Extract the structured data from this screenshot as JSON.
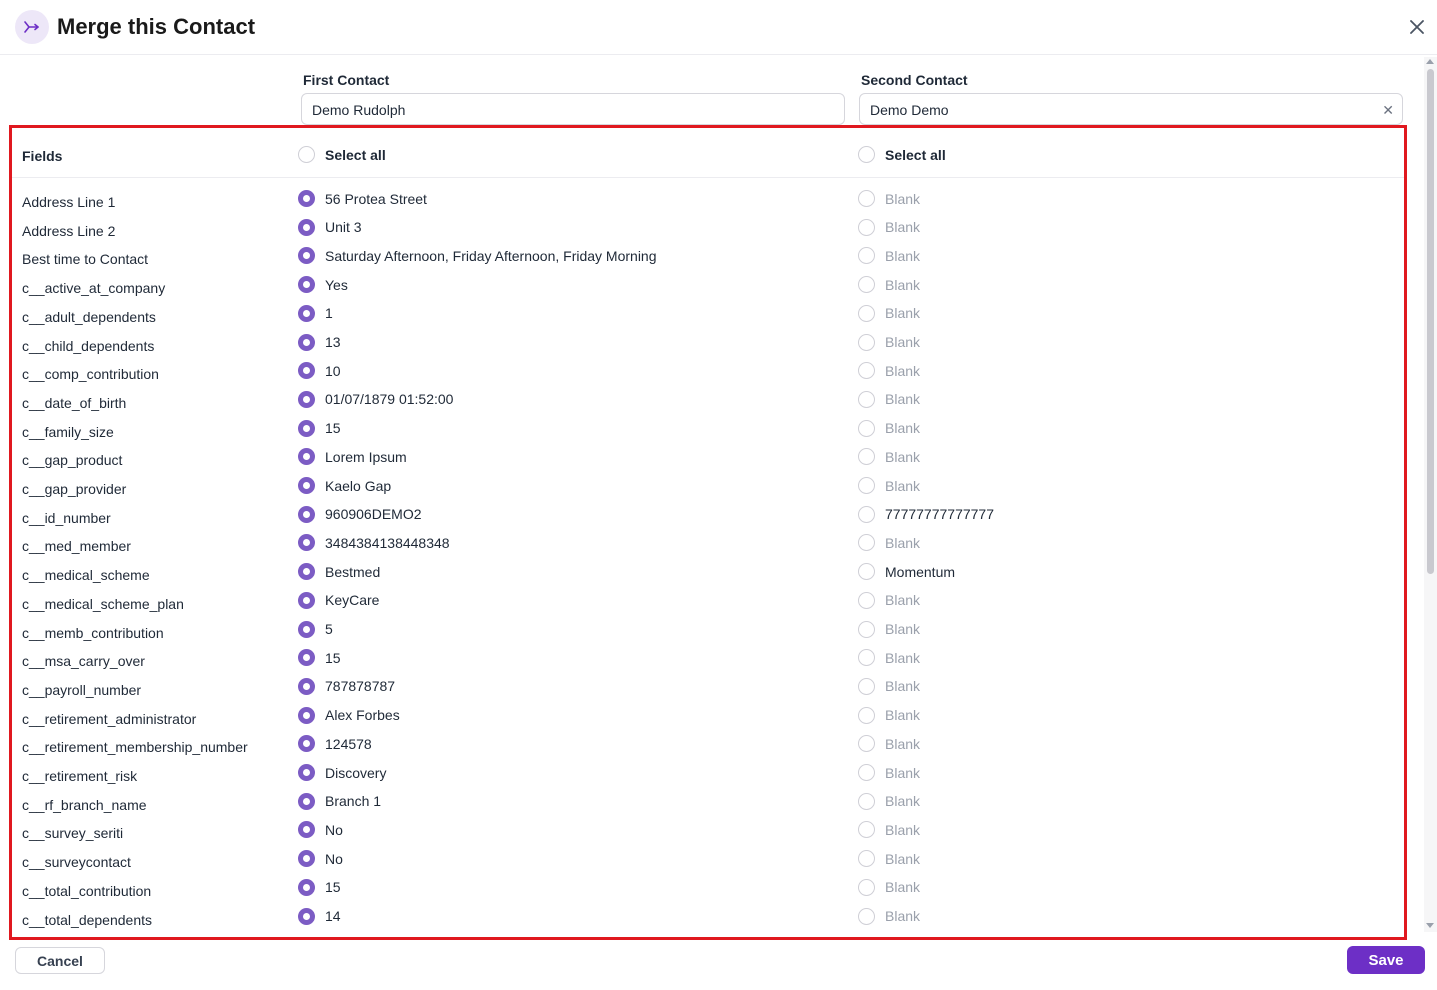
{
  "header": {
    "title": "Merge this Contact",
    "icon": "merge-icon"
  },
  "contacts": {
    "first": {
      "label": "First Contact",
      "value": "Demo Rudolph"
    },
    "second": {
      "label": "Second Contact",
      "value": "Demo Demo"
    }
  },
  "grid": {
    "fields_title": "Fields",
    "select_all_label": "Select all",
    "rows": [
      {
        "field": "Address Line 1",
        "first": "56 Protea Street",
        "second": "Blank",
        "second_blank": true
      },
      {
        "field": "Address Line 2",
        "first": "Unit 3",
        "second": "Blank",
        "second_blank": true
      },
      {
        "field": "Best time to Contact",
        "first": "Saturday Afternoon, Friday Afternoon, Friday Morning",
        "second": "Blank",
        "second_blank": true
      },
      {
        "field": "c__active_at_company",
        "first": "Yes",
        "second": "Blank",
        "second_blank": true
      },
      {
        "field": "c__adult_dependents",
        "first": "1",
        "second": "Blank",
        "second_blank": true
      },
      {
        "field": "c__child_dependents",
        "first": "13",
        "second": "Blank",
        "second_blank": true
      },
      {
        "field": "c__comp_contribution",
        "first": "10",
        "second": "Blank",
        "second_blank": true
      },
      {
        "field": "c__date_of_birth",
        "first": "01/07/1879 01:52:00",
        "second": "Blank",
        "second_blank": true
      },
      {
        "field": "c__family_size",
        "first": "15",
        "second": "Blank",
        "second_blank": true
      },
      {
        "field": "c__gap_product",
        "first": "Lorem Ipsum",
        "second": "Blank",
        "second_blank": true
      },
      {
        "field": "c__gap_provider",
        "first": "Kaelo Gap",
        "second": "Blank",
        "second_blank": true
      },
      {
        "field": "c__id_number",
        "first": "960906DEMO2",
        "second": "77777777777777",
        "second_blank": false
      },
      {
        "field": "c__med_member",
        "first": "3484384138448348",
        "second": "Blank",
        "second_blank": true
      },
      {
        "field": "c__medical_scheme",
        "first": "Bestmed",
        "second": "Momentum",
        "second_blank": false
      },
      {
        "field": "c__medical_scheme_plan",
        "first": "KeyCare",
        "second": "Blank",
        "second_blank": true
      },
      {
        "field": "c__memb_contribution",
        "first": "5",
        "second": "Blank",
        "second_blank": true
      },
      {
        "field": "c__msa_carry_over",
        "first": "15",
        "second": "Blank",
        "second_blank": true
      },
      {
        "field": "c__payroll_number",
        "first": "787878787",
        "second": "Blank",
        "second_blank": true
      },
      {
        "field": "c__retirement_administrator",
        "first": "Alex Forbes",
        "second": "Blank",
        "second_blank": true
      },
      {
        "field": "c__retirement_membership_number",
        "first": "124578",
        "second": "Blank",
        "second_blank": true
      },
      {
        "field": "c__retirement_risk",
        "first": "Discovery",
        "second": "Blank",
        "second_blank": true
      },
      {
        "field": "c__rf_branch_name",
        "first": "Branch 1",
        "second": "Blank",
        "second_blank": true
      },
      {
        "field": "c__survey_seriti",
        "first": "No",
        "second": "Blank",
        "second_blank": true
      },
      {
        "field": "c__surveycontact",
        "first": "No",
        "second": "Blank",
        "second_blank": true
      },
      {
        "field": "c__total_contribution",
        "first": "15",
        "second": "Blank",
        "second_blank": true
      },
      {
        "field": "c__total_dependents",
        "first": "14",
        "second": "Blank",
        "second_blank": true
      }
    ]
  },
  "footer": {
    "cancel_label": "Cancel",
    "save_label": "Save"
  },
  "colors": {
    "accent": "#6d2fc6",
    "radio_checked": "#7c5cc4",
    "highlight": "#e0181f",
    "blank_text": "#9aa0ab"
  }
}
